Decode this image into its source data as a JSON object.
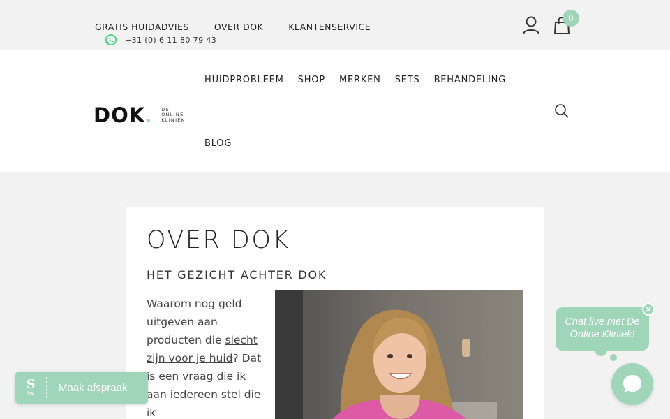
{
  "topbar": {
    "links": [
      "GRATIS HUIDADVIES",
      "OVER DOK",
      "KLANTENSERVICE"
    ],
    "phone": "+31 (0) 6 11 80 79 43",
    "cart_count": "0"
  },
  "logo": {
    "word": "DOK",
    "sub": [
      "DE",
      "ONLINE",
      "KLINIEK"
    ]
  },
  "nav": {
    "items": [
      "HUIDPROBLEEM",
      "SHOP",
      "MERKEN",
      "SETS",
      "BEHANDELING"
    ],
    "blog": "BLOG"
  },
  "content": {
    "title": "OVER DOK",
    "subtitle": "HET GEZICHT ACHTER DOK",
    "intro_before": "Waarom nog geld uitgeven aan producten die ",
    "intro_link": "slecht zijn voor je huid",
    "intro_after": "? Dat is een vraag die ik aan iedereen stel die ik"
  },
  "appointment": {
    "label": "Maak afspraak",
    "logo_s": "S",
    "logo_tw": "tw"
  },
  "chat": {
    "bubble": "Chat live met De Online Kliniek!",
    "close": "×"
  },
  "colors": {
    "accent": "#9fd5b8",
    "topbar_bg": "#f2f2f2",
    "whatsapp": "#25d366"
  }
}
